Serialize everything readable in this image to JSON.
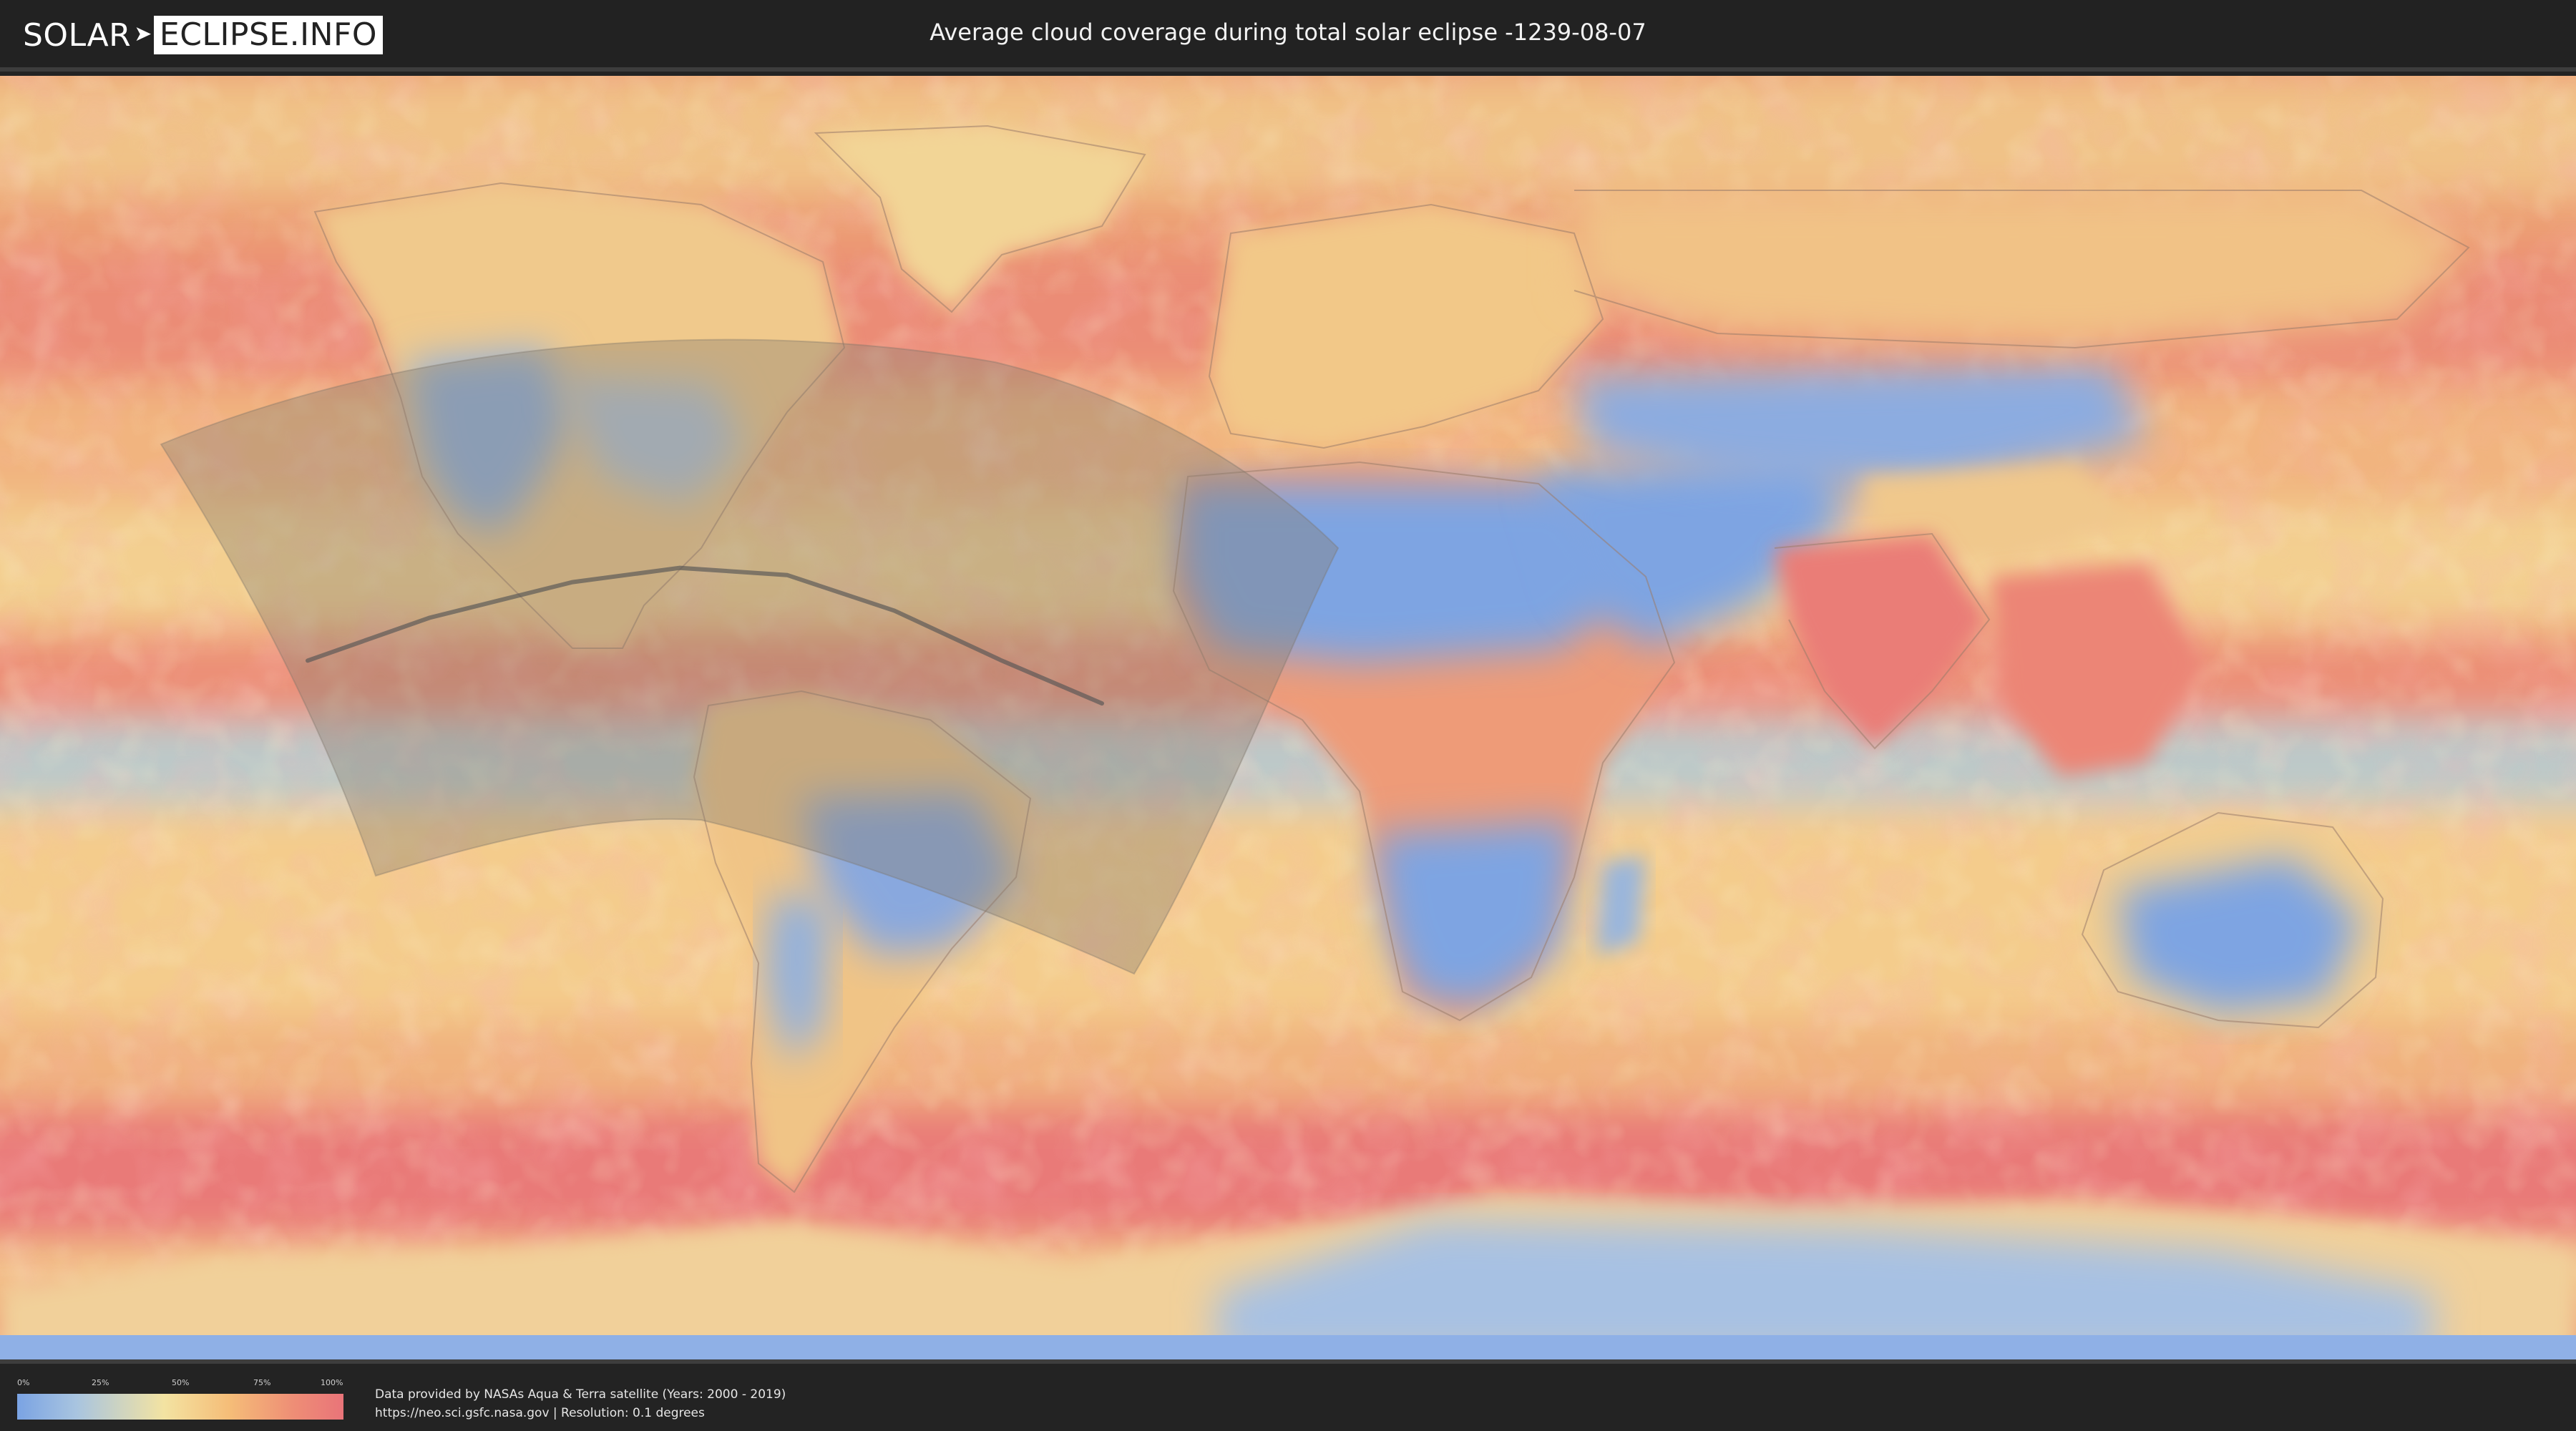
{
  "header": {
    "logo_left": "SOLAR",
    "logo_right": "ECLIPSE.INFO",
    "title": "Average cloud coverage during total solar eclipse -1239-08-07"
  },
  "map": {
    "projection": "equirectangular",
    "colors": {
      "ocean_base": "#e8a372",
      "clear_sky": "#7aa3e3",
      "cloudy": "#e97479",
      "eclipse_zone": "#8a8a7a",
      "central_line": "#555555"
    },
    "eclipse_central_line": [
      {
        "lon": -137,
        "lat": 8
      },
      {
        "lon": -120,
        "lat": 14
      },
      {
        "lon": -100,
        "lat": 19
      },
      {
        "lon": -85,
        "lat": 21
      },
      {
        "lon": -70,
        "lat": 20
      },
      {
        "lon": -55,
        "lat": 15
      },
      {
        "lon": -40,
        "lat": 8
      },
      {
        "lon": -26,
        "lat": 2
      }
    ]
  },
  "legend": {
    "ticks": [
      "0%",
      "25%",
      "50%",
      "75%",
      "100%"
    ],
    "credit_line1": "Data provided by NASAs Aqua & Terra satellite (Years: 2000 - 2019)",
    "credit_line2": "https://neo.sci.gsfc.nasa.gov | Resolution: 0.1 degrees"
  }
}
